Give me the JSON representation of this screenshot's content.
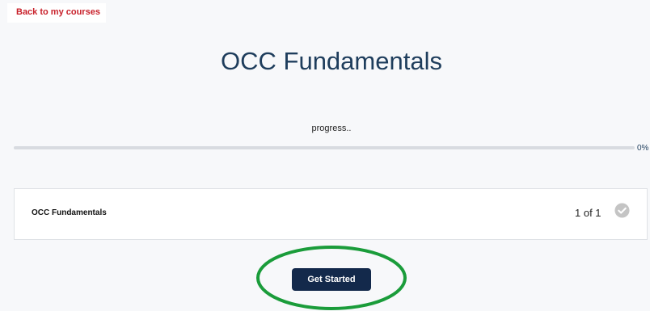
{
  "nav": {
    "back_label": "Back to my courses"
  },
  "course": {
    "title": "OCC Fundamentals"
  },
  "progress": {
    "label": "progress..",
    "percent_text": "0%",
    "value": 0
  },
  "module": {
    "name": "OCC Fundamentals",
    "count_text": "1 of 1",
    "status_icon": "check-circle-icon"
  },
  "actions": {
    "start_label": "Get Started"
  },
  "colors": {
    "accent": "#1e3d5c",
    "button": "#13294b",
    "link": "#c8202a",
    "highlight": "#1a9c3a",
    "check": "#c4c4c4"
  }
}
